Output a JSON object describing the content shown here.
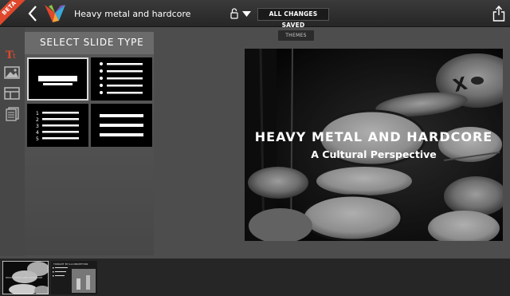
{
  "topbar": {
    "beta_label": "BETA",
    "document_title": "Heavy metal and hardcore",
    "save_status": "ALL CHANGES SAVED"
  },
  "themes_tab": {
    "label": "THEMES"
  },
  "tools": [
    "text-tool-icon",
    "image-tool-icon",
    "layout-tool-icon",
    "notes-tool-icon"
  ],
  "panel": {
    "title": "SELECT SLIDE TYPE",
    "types": [
      "title",
      "bulleted-list",
      "numbered-list",
      "lines"
    ],
    "numbered_list_numbers": [
      "1",
      "2",
      "3",
      "4",
      "5"
    ]
  },
  "slide": {
    "title": "HEAVY METAL AND HARDCORE",
    "subtitle": "A Cultural Perspective"
  },
  "filmstrip": {
    "thumbnails": [
      {
        "caption": "HEAVY METAL AND HARDCORE",
        "selected": true
      },
      {
        "caption": "TONIGHT BY ILLCONCEPTION",
        "selected": false
      }
    ]
  },
  "colors": {
    "accent": "#e0482c",
    "topbar": "#2e2e2e",
    "background": "#4d4d4d"
  }
}
